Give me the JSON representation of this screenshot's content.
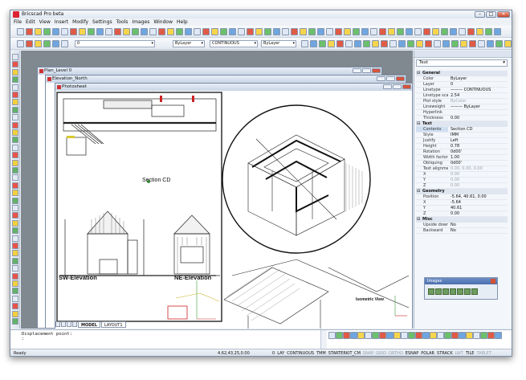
{
  "window": {
    "title": "Bricscad Pro beta"
  },
  "menu": [
    "File",
    "Edit",
    "View",
    "Insert",
    "Modify",
    "Settings",
    "Tools",
    "Images",
    "Window",
    "Help"
  ],
  "toolbar2": {
    "layer_value": "0",
    "color_value": "ByLayer",
    "linetype_value": "CONTINUOUS",
    "lineweight_value": "ByLayer"
  },
  "docs": {
    "plan": "Plan_Level 0",
    "elevation": "Elevation_North",
    "photosheet": "Photosheet"
  },
  "drawing": {
    "section_label": "Section CD",
    "sw_label": "SW-Elevation",
    "ne_label": "NE-Elevation",
    "iso_label": "Isometric View"
  },
  "tabs": {
    "model": "MODEL",
    "layout": "LAYOUT1"
  },
  "panel": {
    "selector": "Text"
  },
  "properties": [
    {
      "section": "General",
      "rows": [
        {
          "k": "Color",
          "v": "ByLayer"
        },
        {
          "k": "Layer",
          "v": "0"
        },
        {
          "k": "Linetype",
          "v": "——— CONTINUOUS"
        },
        {
          "k": "Linetype scale",
          "v": "2.54"
        },
        {
          "k": "Plot style",
          "v": "ByColor",
          "gray": true
        },
        {
          "k": "Lineweight",
          "v": "——— ByLayer"
        },
        {
          "k": "Hyperlink",
          "v": ""
        },
        {
          "k": "Thickness",
          "v": "0.00"
        }
      ]
    },
    {
      "section": "Text",
      "rows": [
        {
          "k": "Contents",
          "v": "Section CD",
          "sel": true
        },
        {
          "k": "Style",
          "v": "IMM"
        },
        {
          "k": "Justify",
          "v": "Left"
        },
        {
          "k": "Height",
          "v": "0.78"
        },
        {
          "k": "Rotation",
          "v": "0d00'"
        },
        {
          "k": "Width factor",
          "v": "1.00"
        },
        {
          "k": "Obliquing",
          "v": "0d00'"
        },
        {
          "k": "Text alignment",
          "v": "0.00, 0.00, 0.00",
          "gray": true
        },
        {
          "k": "X",
          "v": "0.00",
          "gray": true
        },
        {
          "k": "Y",
          "v": "0.00",
          "gray": true
        },
        {
          "k": "Z",
          "v": "0.00",
          "gray": true
        }
      ]
    },
    {
      "section": "Geometry",
      "rows": [
        {
          "k": "Position",
          "v": "-5.64, 40.61, 0.00"
        },
        {
          "k": "X",
          "v": "-5.64"
        },
        {
          "k": "Y",
          "v": "40.61"
        },
        {
          "k": "Z",
          "v": "0.00"
        }
      ]
    },
    {
      "section": "Misc",
      "rows": [
        {
          "k": "Upside down",
          "v": "No"
        },
        {
          "k": "Backward",
          "v": "No"
        }
      ]
    }
  ],
  "images_palette": {
    "title": "Images"
  },
  "command": {
    "line1": "Displacement point:",
    "line2": ":"
  },
  "status": {
    "ready": "Ready",
    "coords": "4.62,43.25,0.00",
    "toggles": [
      "0",
      "LAY",
      "CONTINUOUS",
      "TMM",
      "STARTERKIT_CM",
      "SNAP",
      "GRID",
      "ORTHO",
      "ESNAP",
      "POLAR",
      "STRACK",
      "LWT",
      "TILE",
      "TABLET"
    ],
    "dim": [
      "SNAP",
      "GRID",
      "ORTHO",
      "LWT",
      "TABLET"
    ]
  }
}
